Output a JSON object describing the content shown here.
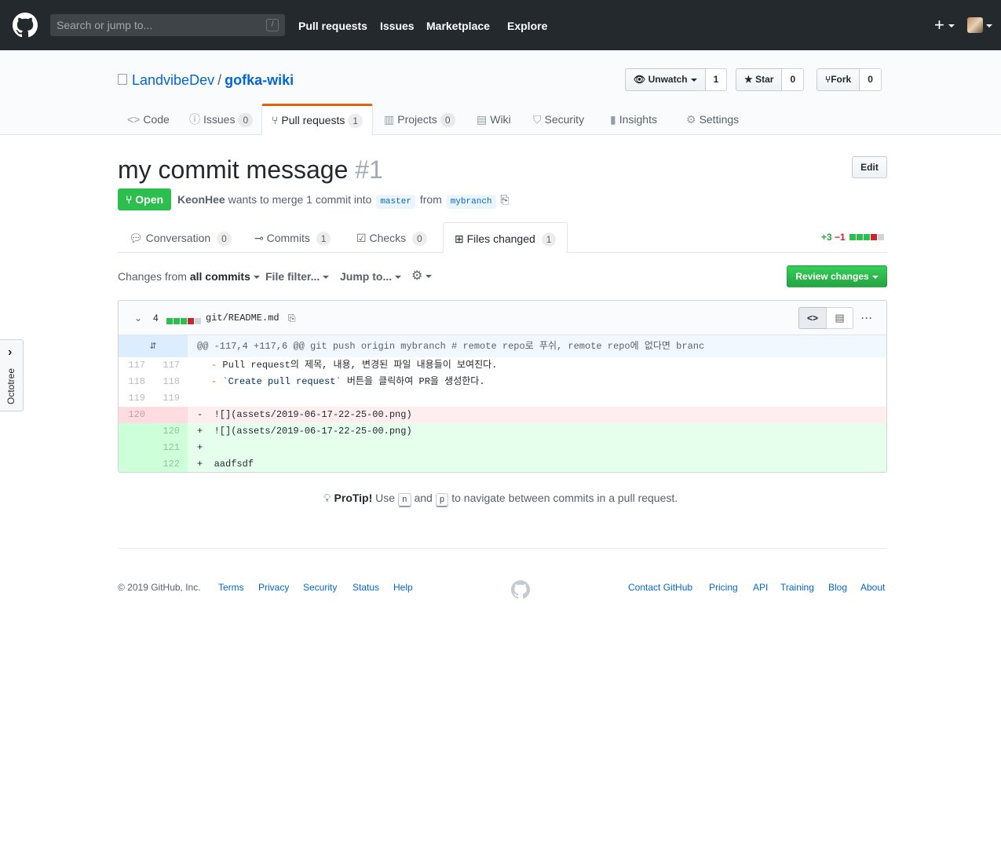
{
  "header": {
    "search_placeholder": "Search or jump to...",
    "search_shortcut": "/",
    "nav": [
      "Pull requests",
      "Issues",
      "Marketplace",
      "Explore"
    ],
    "plus": "+"
  },
  "repo": {
    "owner": "LandvibeDev",
    "separator": "/",
    "name": "gofka-wiki",
    "watch_label": "Unwatch",
    "watch_count": "1",
    "star_label": "Star",
    "star_count": "0",
    "fork_label": "Fork",
    "fork_count": "0",
    "tabs": [
      {
        "label": "Code",
        "icon": "<>",
        "count": ""
      },
      {
        "label": "Issues",
        "icon": "ⓘ",
        "count": "0"
      },
      {
        "label": "Pull requests",
        "icon": "⑂",
        "count": "1"
      },
      {
        "label": "Projects",
        "icon": "▥",
        "count": "0"
      },
      {
        "label": "Wiki",
        "icon": "▤",
        "count": ""
      },
      {
        "label": "Security",
        "icon": "⛉",
        "count": ""
      },
      {
        "label": "Insights",
        "icon": "▮",
        "count": ""
      },
      {
        "label": "Settings",
        "icon": "⚙",
        "count": ""
      }
    ]
  },
  "pr": {
    "title": "my commit message",
    "number": "#1",
    "edit_label": "Edit",
    "state": "Open",
    "author": "KeonHee",
    "meta_mid": "wants to merge 1 commit into",
    "base": "master",
    "from": "from",
    "head": "mybranch",
    "tabs": [
      {
        "label": "Conversation",
        "count": "0"
      },
      {
        "label": "Commits",
        "count": "1"
      },
      {
        "label": "Checks",
        "count": "0"
      },
      {
        "label": "Files changed",
        "count": "1"
      }
    ],
    "additions": "+3",
    "deletions": "−1"
  },
  "toolbar": {
    "changes_prefix": "Changes from",
    "changes_value": "all commits",
    "file_filter": "File filter...",
    "jump_to": "Jump to...",
    "review_button": "Review changes"
  },
  "diff": {
    "change_count": "4",
    "filename": "git/README.md",
    "hunk_header": "@@ -117,4 +117,6 @@ git push origin mybranch # remote repo로 푸쉬, remote repo에 없다면 branc",
    "rows": [
      {
        "old": "117",
        "new": "117",
        "bullet": "-",
        "text": " Pull request의 제목, 내용, 변경된 파일 내용들이 보여진다.",
        "type": "ctx"
      },
      {
        "old": "118",
        "new": "118",
        "bullet": "-",
        "text_code": "`Create pull request`",
        "text_after": " 버튼을 클릭하여 PR을 생성한다.",
        "type": "ctx"
      },
      {
        "old": "119",
        "new": "119",
        "text": "",
        "type": "ctx"
      },
      {
        "old": "120",
        "new": "",
        "sign": "-",
        "text": "![](assets/2019-06-17-22-25-00.png)",
        "type": "del"
      },
      {
        "old": "",
        "new": "120",
        "sign": "+",
        "text": "![](assets/2019-06-17-22-25-00.png)",
        "type": "add"
      },
      {
        "old": "",
        "new": "121",
        "sign": "+",
        "text": "",
        "type": "add"
      },
      {
        "old": "",
        "new": "122",
        "sign": "+",
        "text": "aadfsdf",
        "type": "add"
      }
    ]
  },
  "protip": {
    "label": "ProTip!",
    "use": "Use",
    "key_n": "n",
    "and": "and",
    "key_p": "p",
    "rest": "to navigate between commits in a pull request."
  },
  "footer": {
    "copyright": "© 2019 GitHub, Inc.",
    "left_links": [
      "Terms",
      "Privacy",
      "Security",
      "Status",
      "Help"
    ],
    "right_links": [
      "Contact GitHub",
      "Pricing",
      "API",
      "Training",
      "Blog",
      "About"
    ]
  },
  "octotree": {
    "label": "Octotree",
    "chevron": "›"
  },
  "colors": {
    "header_bg": "#24292e",
    "open_green": "#2cbe4e",
    "link_blue": "#0366d6",
    "tab_accent": "#e36209",
    "add_bg": "#e6ffed",
    "del_bg": "#ffeef0"
  }
}
